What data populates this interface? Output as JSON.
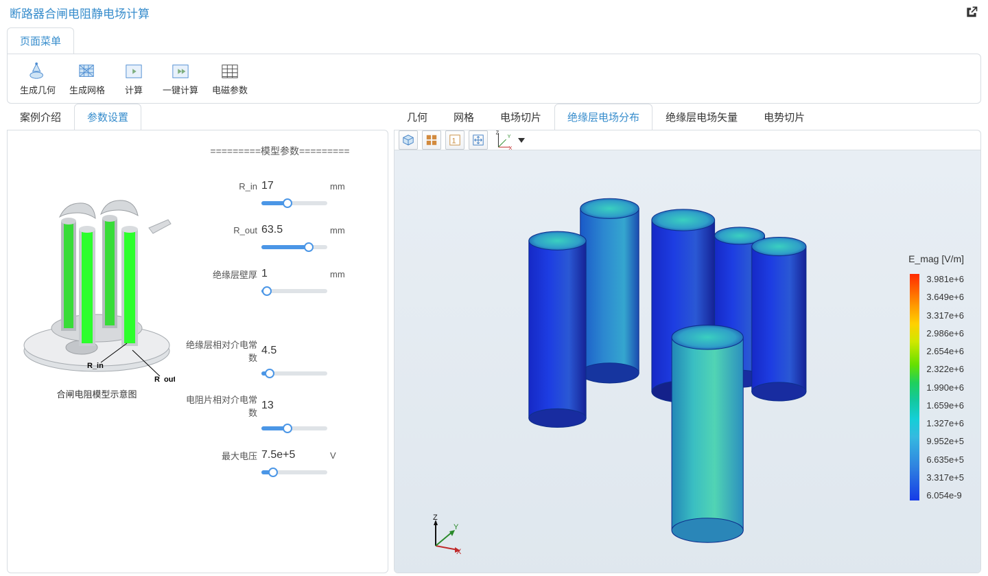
{
  "app": {
    "title": "断路器合闸电阻静电场计算"
  },
  "frame_tab": "页面菜单",
  "toolbar": [
    {
      "id": "gen-geom-button",
      "label": "生成几何"
    },
    {
      "id": "gen-mesh-button",
      "label": "生成网格"
    },
    {
      "id": "compute-button",
      "label": "计算"
    },
    {
      "id": "one-click-button",
      "label": "一键计算"
    },
    {
      "id": "em-param-button",
      "label": "电磁参数"
    }
  ],
  "left": {
    "tabs": [
      "案例介绍",
      "参数设置"
    ],
    "active_tab_index": 1,
    "heading_decor": "=========模型参数=========",
    "caption": "合闸电阻模型示意图",
    "diagram_labels": {
      "R_in": "R_in",
      "R_out": "R_out"
    },
    "params": [
      {
        "id": "r-in",
        "label": "R_in",
        "value": "17",
        "unit": "mm",
        "fill_pct": 40
      },
      {
        "id": "r-out",
        "label": "R_out",
        "value": "63.5",
        "unit": "mm",
        "fill_pct": 72
      },
      {
        "id": "ins-thickness",
        "label": "绝缘层壁厚",
        "value": "1",
        "unit": "mm",
        "fill_pct": 8
      },
      {
        "id": "ins-permittivity",
        "label": "绝缘层相对介电常数",
        "value": "4.5",
        "unit": "",
        "fill_pct": 12
      },
      {
        "id": "res-permittivity",
        "label": "电阻片相对介电常数",
        "value": "13",
        "unit": "",
        "fill_pct": 40
      },
      {
        "id": "max-voltage",
        "label": "最大电压",
        "value": "7.5e+5",
        "unit": "V",
        "fill_pct": 18
      }
    ]
  },
  "right": {
    "tabs": [
      "几何",
      "网格",
      "电场切片",
      "绝缘层电场分布",
      "绝缘层电场矢量",
      "电势切片"
    ],
    "active_tab_index": 3,
    "mini_toolbar_names": [
      "view-cube-icon",
      "reset-view-icon",
      "scene-light-icon",
      "move-icon"
    ],
    "axis_labels": {
      "x": "X",
      "y": "Y",
      "z": "Z"
    },
    "legend": {
      "title": "E_mag [V/m]",
      "labels": [
        "3.981e+6",
        "3.649e+6",
        "3.317e+6",
        "2.986e+6",
        "2.654e+6",
        "2.322e+6",
        "1.990e+6",
        "1.659e+6",
        "1.327e+6",
        "9.952e+5",
        "6.635e+5",
        "3.317e+5",
        "6.054e-9"
      ]
    }
  }
}
